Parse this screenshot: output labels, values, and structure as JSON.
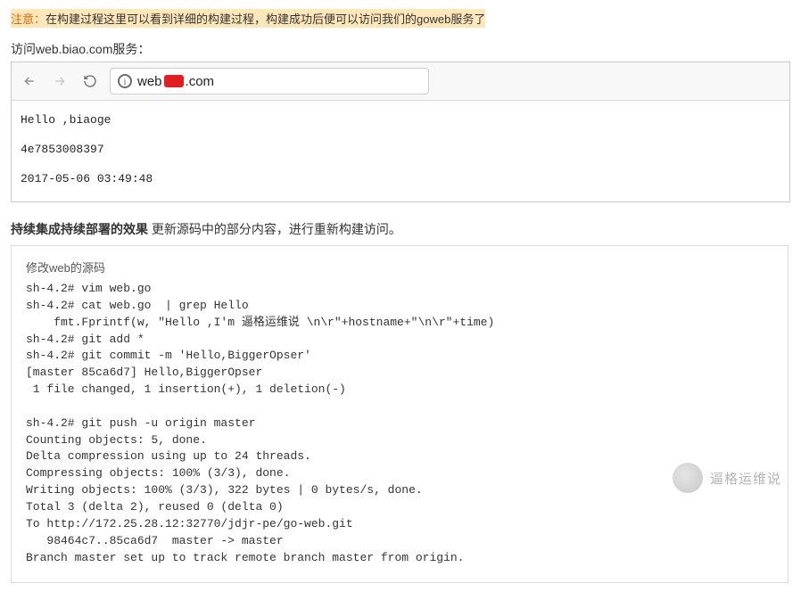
{
  "note": {
    "prefix": "注意：",
    "body": "在构建过程这里可以看到详细的构建过程，构建成功后便可以访问我们的goweb服务了"
  },
  "access_label": "访问web.biao.com服务：",
  "browser": {
    "url_left": "web",
    "url_right": ".com",
    "body_line1": "Hello ,biaoge",
    "body_line2": "4e7853008397",
    "body_line3": "2017-05-06 03:49:48"
  },
  "subhead": {
    "bold": "持续集成持续部署的效果",
    "rest": " 更新源码中的部分内容，进行重新构建访问。"
  },
  "code": {
    "caption": "修改web的源码",
    "body": "sh-4.2# vim web.go\nsh-4.2# cat web.go  | grep Hello\n    fmt.Fprintf(w, \"Hello ,I'm 逼格运维说 \\n\\r\"+hostname+\"\\n\\r\"+time)\nsh-4.2# git add *\nsh-4.2# git commit -m 'Hello,BiggerOpser'\n[master 85ca6d7] Hello,BiggerOpser\n 1 file changed, 1 insertion(+), 1 deletion(-)\n\nsh-4.2# git push -u origin master\nCounting objects: 5, done.\nDelta compression using up to 24 threads.\nCompressing objects: 100% (3/3), done.\nWriting objects: 100% (3/3), 322 bytes | 0 bytes/s, done.\nTotal 3 (delta 2), reused 0 (delta 0)\nTo http://172.25.28.12:32770/jdjr-pe/go-web.git\n   98464c7..85ca6d7  master -> master\nBranch master set up to track remote branch master from origin."
  },
  "watermark": "逼格运维说"
}
